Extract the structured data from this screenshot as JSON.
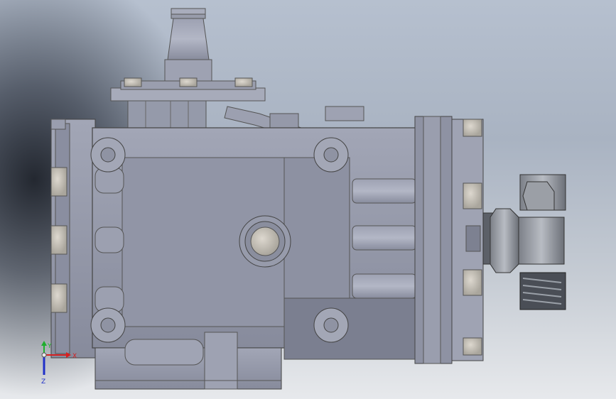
{
  "viewport": {
    "background_top": "#b6c0cf",
    "background_bottom": "#e7e9ec"
  },
  "model": {
    "body_color": "#9296a7",
    "body_dark": "#6f7385",
    "body_light": "#b4b8c7",
    "bolt_color": "#c9c5bc",
    "fitting_color": "#8a8e98"
  },
  "triad": {
    "y_label": "Y",
    "x_label": "X",
    "z_label": "Z",
    "y_color": "#1fae2e",
    "x_color": "#d62020",
    "z_color": "#2030c8"
  }
}
